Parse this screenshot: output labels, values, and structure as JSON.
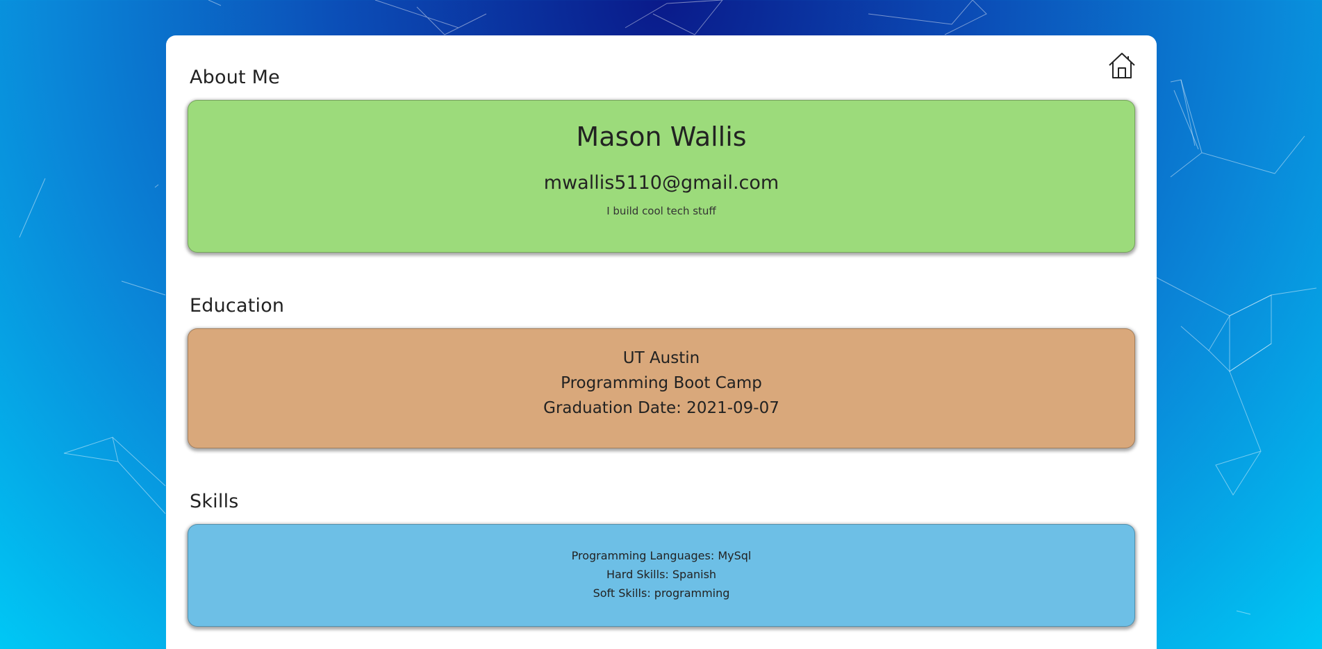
{
  "nav": {
    "home_icon": "home-icon"
  },
  "about": {
    "heading": "About Me",
    "name": "Mason Wallis",
    "email": "mwallis5110@gmail.com",
    "bio": "I build cool tech stuff",
    "color": "#9cdb7b"
  },
  "education": {
    "heading": "Education",
    "school": "UT Austin",
    "program": "Programming Boot Camp",
    "graduation": "Graduation Date: 2021-09-07",
    "color": "#d9a87b"
  },
  "skills": {
    "heading": "Skills",
    "languages": "Programming Languages: MySql",
    "hard": "Hard Skills: Spanish",
    "soft": "Soft Skills: programming",
    "color": "#6dbfe6"
  }
}
